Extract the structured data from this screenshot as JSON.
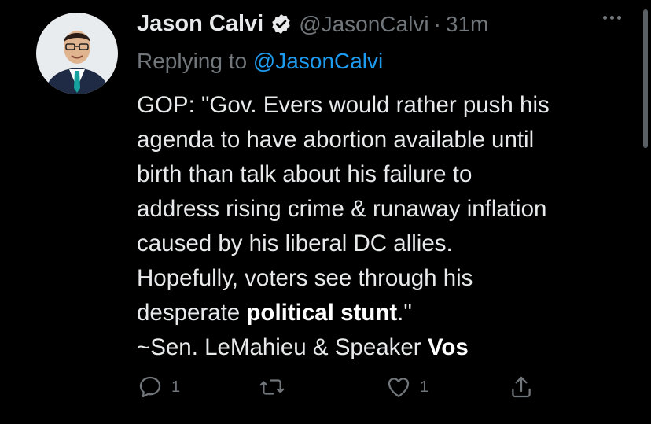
{
  "tweet": {
    "author_name": "Jason Calvi",
    "handle": "@JasonCalvi",
    "separator": "·",
    "time": "31m",
    "replying_prefix": "Replying to ",
    "replying_to": "@JasonCalvi",
    "lines": [
      "GOP: \"Gov. Evers would rather push his",
      "agenda to have abortion available until",
      "birth than talk about his failure to",
      "address rising crime & runaway inflation",
      "caused by his liberal DC allies.",
      "Hopefully, voters see through his"
    ],
    "line7_pre": "desperate ",
    "line7_bold": "political stunt",
    "line7_post": ".\"",
    "line8_pre": "~Sen. LeMahieu & Speaker ",
    "line8_bold": "Vos"
  },
  "actions": {
    "reply_count": "1",
    "retweet_count": "",
    "like_count": "1"
  },
  "icons": {
    "verified": "verified-badge-icon",
    "more": "more-icon",
    "reply": "reply-icon",
    "retweet": "retweet-icon",
    "like": "like-icon",
    "share": "share-icon"
  },
  "colors": {
    "background": "#000000",
    "text": "#e7e9ea",
    "secondary": "#71767b",
    "link": "#1d9bf0"
  }
}
